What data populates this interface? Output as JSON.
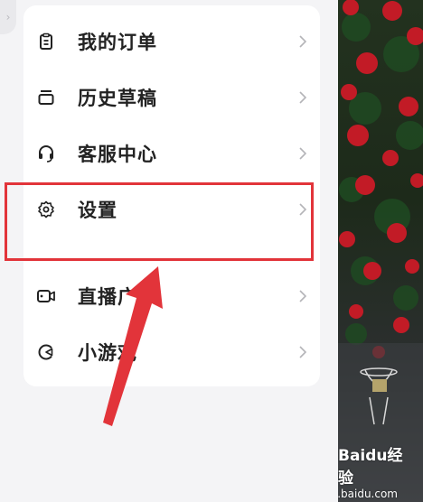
{
  "menu": {
    "items": [
      {
        "label": "我的订单",
        "icon": "clipboard-icon"
      },
      {
        "label": "历史草稿",
        "icon": "drafts-tray-icon"
      },
      {
        "label": "客服中心",
        "icon": "headset-icon"
      },
      {
        "label": "设置",
        "icon": "gear-icon"
      },
      {
        "label": "直播广",
        "icon": "video-camera-icon"
      },
      {
        "label": "小游戏",
        "icon": "game-icon"
      }
    ]
  },
  "watermark": {
    "brand": "Baidu经验",
    "sub": "jingyan.baidu.com"
  },
  "colors": {
    "highlight": "#e2343a",
    "arrow": "#e2343a",
    "card": "#ffffff",
    "background": "#f4f4f6"
  }
}
